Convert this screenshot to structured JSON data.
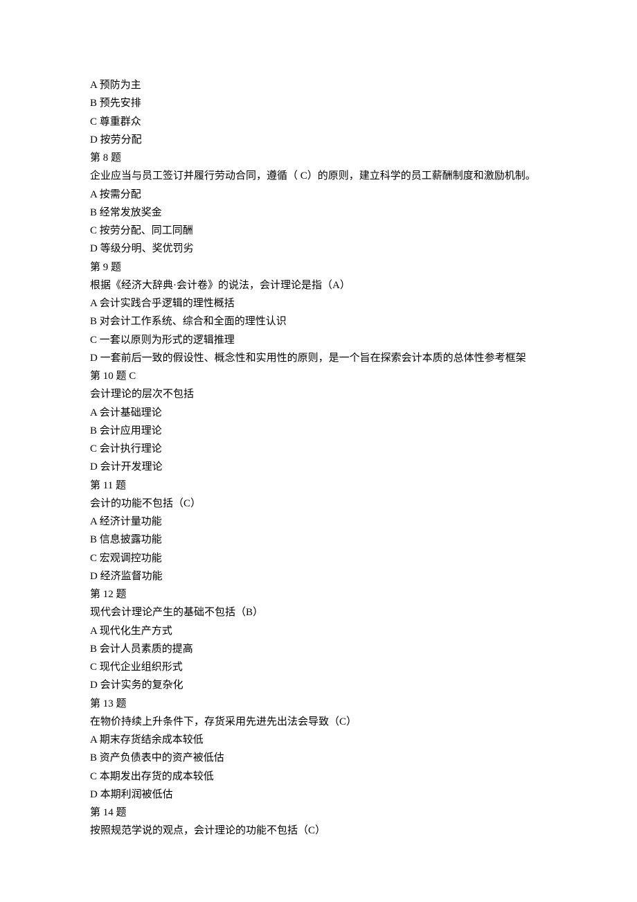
{
  "lines": [
    "A 预防为主",
    "B 预先安排",
    "C 尊重群众",
    "D 按劳分配",
    "第 8 题",
    "企业应当与员工签订并履行劳动合同，遵循（ C）的原则，建立科学的员工薪酬制度和激励机制。",
    "A 按需分配",
    "B 经常发放奖金",
    "C 按劳分配、同工同酬",
    "D 等级分明、奖优罚劣",
    "第 9 题",
    "根据《经济大辞典·会计卷》的说法，会计理论是指（A）",
    "A 会计实践合乎逻辑的理性概括",
    "B 对会计工作系统、综合和全面的理性认识",
    "C 一套以原则为形式的逻辑推理",
    "D 一套前后一致的假设性、概念性和实用性的原则，是一个旨在探索会计本质的总体性参考框架",
    "第 10 题 C",
    "会计理论的层次不包括",
    "A 会计基础理论",
    "B 会计应用理论",
    "C 会计执行理论",
    "D 会计开发理论",
    "第 11 题",
    "会计的功能不包括（C）",
    "A 经济计量功能",
    "B 信息披露功能",
    "C 宏观调控功能",
    "D 经济监督功能",
    "第 12 题",
    "现代会计理论产生的基础不包括（B）",
    "A 现代化生产方式",
    "B 会计人员素质的提高",
    "C 现代企业组织形式",
    "D 会计实务的复杂化",
    "第 13 题",
    "在物价持续上升条件下，存货采用先进先出法会导致（C）",
    "A 期末存货结余成本较低",
    "B 资产负债表中的资产被低估",
    "C 本期发出存货的成本较低",
    "D 本期利润被低估",
    "第 14 题",
    "按照规范学说的观点，会计理论的功能不包括（C）"
  ]
}
